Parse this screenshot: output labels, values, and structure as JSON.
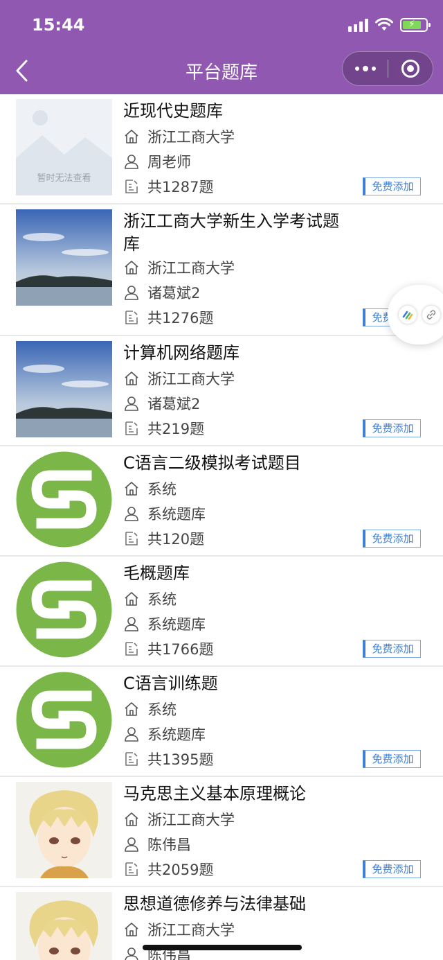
{
  "status_bar": {
    "time": "15:44"
  },
  "nav": {
    "title": "平台题库"
  },
  "item_button_label": "免费添加",
  "items": [
    {
      "title": "近现代史题库",
      "school": "浙江工商大学",
      "teacher": "周老师",
      "count": "共1287题",
      "thumb": "placeholder",
      "placeholder_text": "暂时无法查看"
    },
    {
      "title": "浙江工商大学新生入学考试题库",
      "school": "浙江工商大学",
      "teacher": "诸葛斌2",
      "count": "共1276题",
      "thumb": "landscape"
    },
    {
      "title": "计算机网络题库",
      "school": "浙江工商大学",
      "teacher": "诸葛斌2",
      "count": "共219题",
      "thumb": "landscape"
    },
    {
      "title": "C语言二级模拟考试题目",
      "school": "系统",
      "teacher": "系统题库",
      "count": "共120题",
      "thumb": "green-logo"
    },
    {
      "title": "毛概题库",
      "school": "系统",
      "teacher": "系统题库",
      "count": "共1766题",
      "thumb": "green-logo"
    },
    {
      "title": "C语言训练题",
      "school": "系统",
      "teacher": "系统题库",
      "count": "共1395题",
      "thumb": "green-logo"
    },
    {
      "title": "马克思主义基本原理概论",
      "school": "浙江工商大学",
      "teacher": "陈伟昌",
      "count": "共2059题",
      "thumb": "anime-avatar"
    },
    {
      "title": "思想道德修养与法律基础",
      "school": "浙江工商大学",
      "teacher": "陈伟昌",
      "count": "",
      "thumb": "anime-avatar"
    }
  ],
  "colors": {
    "header_bg": "#9158b2",
    "accent": "#3f7fd5",
    "logo_green": "#7ab648"
  }
}
